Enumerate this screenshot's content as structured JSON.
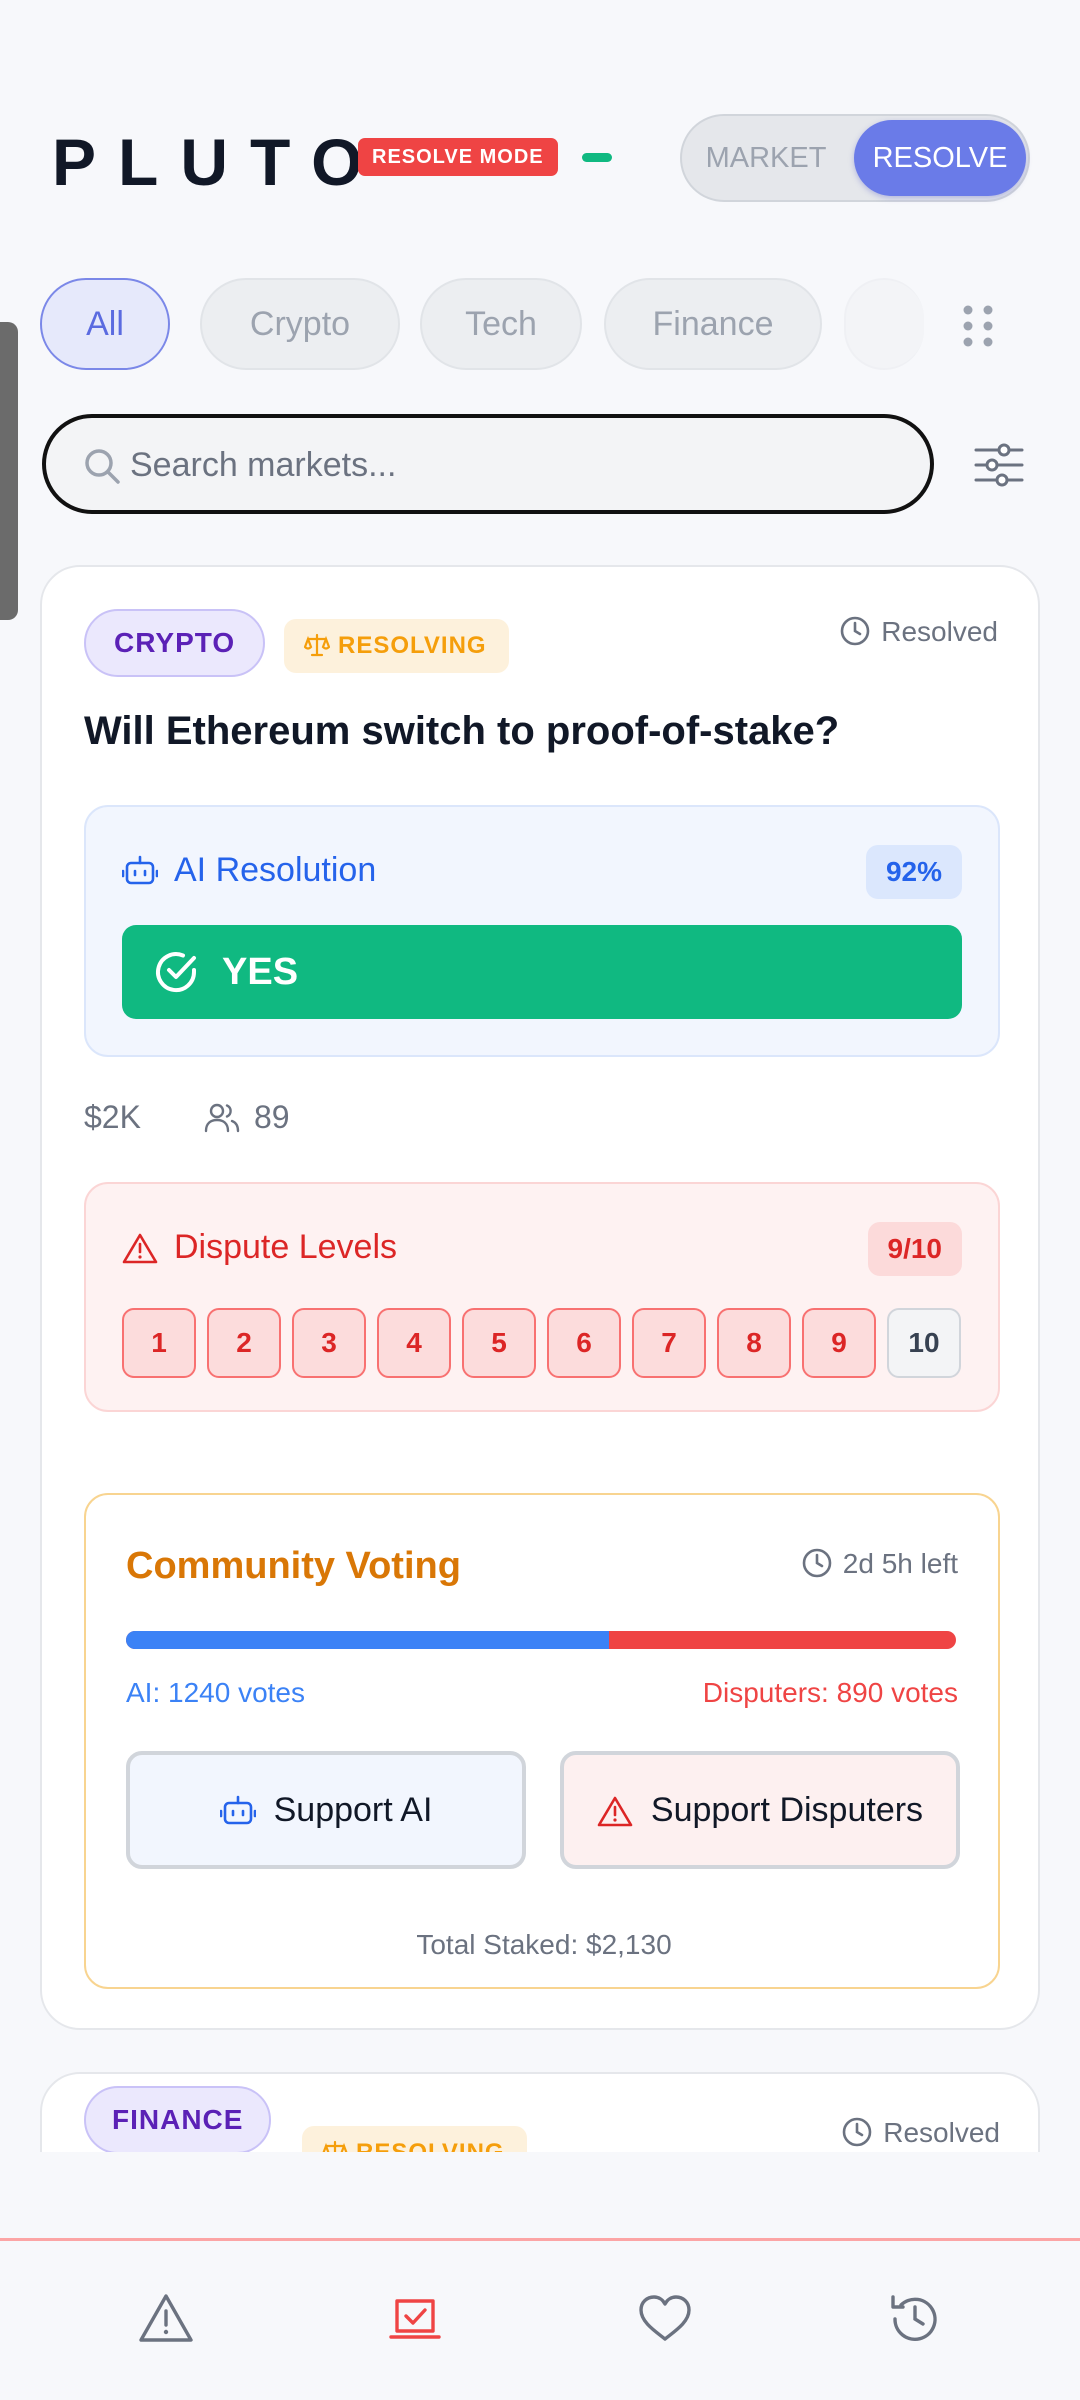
{
  "app": {
    "logo": "PLUTO",
    "mode_badge": "RESOLVE MODE",
    "toggle": {
      "market_label": "MARKET",
      "resolve_label": "RESOLVE",
      "selected": "RESOLVE"
    }
  },
  "categories": [
    {
      "label": "All",
      "active": true
    },
    {
      "label": "Crypto",
      "active": false
    },
    {
      "label": "Tech",
      "active": false
    },
    {
      "label": "Finance",
      "active": false
    }
  ],
  "search": {
    "placeholder": "Search markets...",
    "value": ""
  },
  "market": {
    "category_tag": "CRYPTO",
    "status_tag": "RESOLVING",
    "resolved_label": "Resolved",
    "question": "Will Ethereum switch to proof-of-stake?",
    "ai_resolution": {
      "title": "AI Resolution",
      "confidence": "92%",
      "result": "YES"
    },
    "pool": "$2K",
    "participants": "89",
    "dispute": {
      "title": "Dispute Levels",
      "count": "9/10",
      "levels": [
        "1",
        "2",
        "3",
        "4",
        "5",
        "6",
        "7",
        "8",
        "9",
        "10"
      ],
      "active_levels": 9
    },
    "voting": {
      "title": "Community Voting",
      "time_left": "2d 5h left",
      "ai_votes_label": "AI: 1240 votes",
      "disputers_votes_label": "Disputers: 890 votes",
      "ai_votes": 1240,
      "disputer_votes": 890,
      "support_ai_label": "Support AI",
      "support_disputers_label": "Support Disputers",
      "total_staked": "Total Staked: $2,130"
    }
  },
  "next_market": {
    "category_tag": "FINANCE",
    "status_tag": "RESOLVING",
    "resolved_label": "Resolved"
  },
  "bottom_nav": [
    "alert-icon",
    "resolve-check-icon",
    "heart-icon",
    "history-icon"
  ],
  "colors": {
    "accent": "#6a7be8",
    "resolve_red": "#ef4444",
    "yes_green": "#10b981",
    "ai_blue": "#3b82f6",
    "voting_orange": "#d97706"
  }
}
